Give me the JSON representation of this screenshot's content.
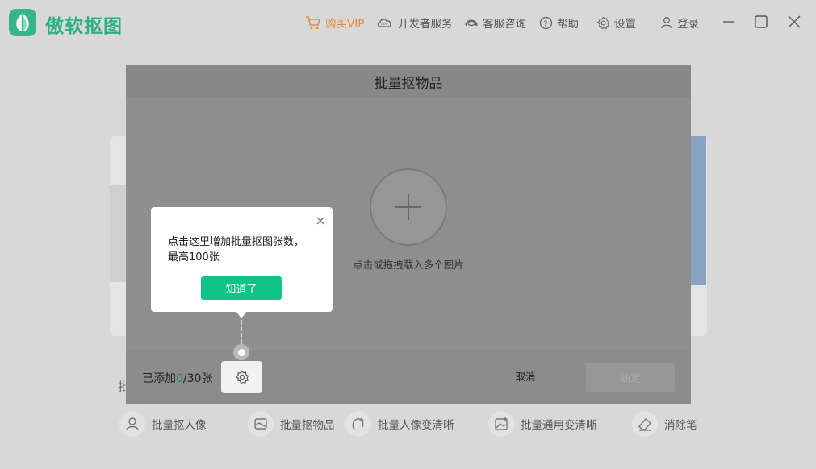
{
  "app": {
    "name": "傲软抠图"
  },
  "topnav": {
    "vip": "购买VIP",
    "developer": "开发者服务",
    "support": "客服咨询",
    "help": "帮助",
    "settings": "设置",
    "login": "登录"
  },
  "background": {
    "section_label_fragment": "批",
    "tools": [
      {
        "label": "批量抠人像",
        "icon": "person-icon"
      },
      {
        "label": "批量抠物品",
        "icon": "box-icon"
      },
      {
        "label": "批量人像变清晰",
        "icon": "face-enhance-icon"
      },
      {
        "label": "批量通用变清晰",
        "icon": "image-enhance-icon"
      },
      {
        "label": "消除笔",
        "icon": "eraser-icon"
      }
    ]
  },
  "modal": {
    "title": "批量抠物品",
    "upload_hint": "点击或拖拽载入多个图片",
    "count_prefix": "已添加",
    "count_current": "0",
    "count_suffix": "/30张",
    "cancel_label": "取消",
    "confirm_label": "确定"
  },
  "tooltip": {
    "line1": "点击这里增加批量抠图张数，",
    "line2": "最高100张",
    "button_label": "知道了"
  },
  "colors": {
    "brand": "#2fae84",
    "vip": "#e58a3b",
    "tip_button": "#10c287"
  }
}
